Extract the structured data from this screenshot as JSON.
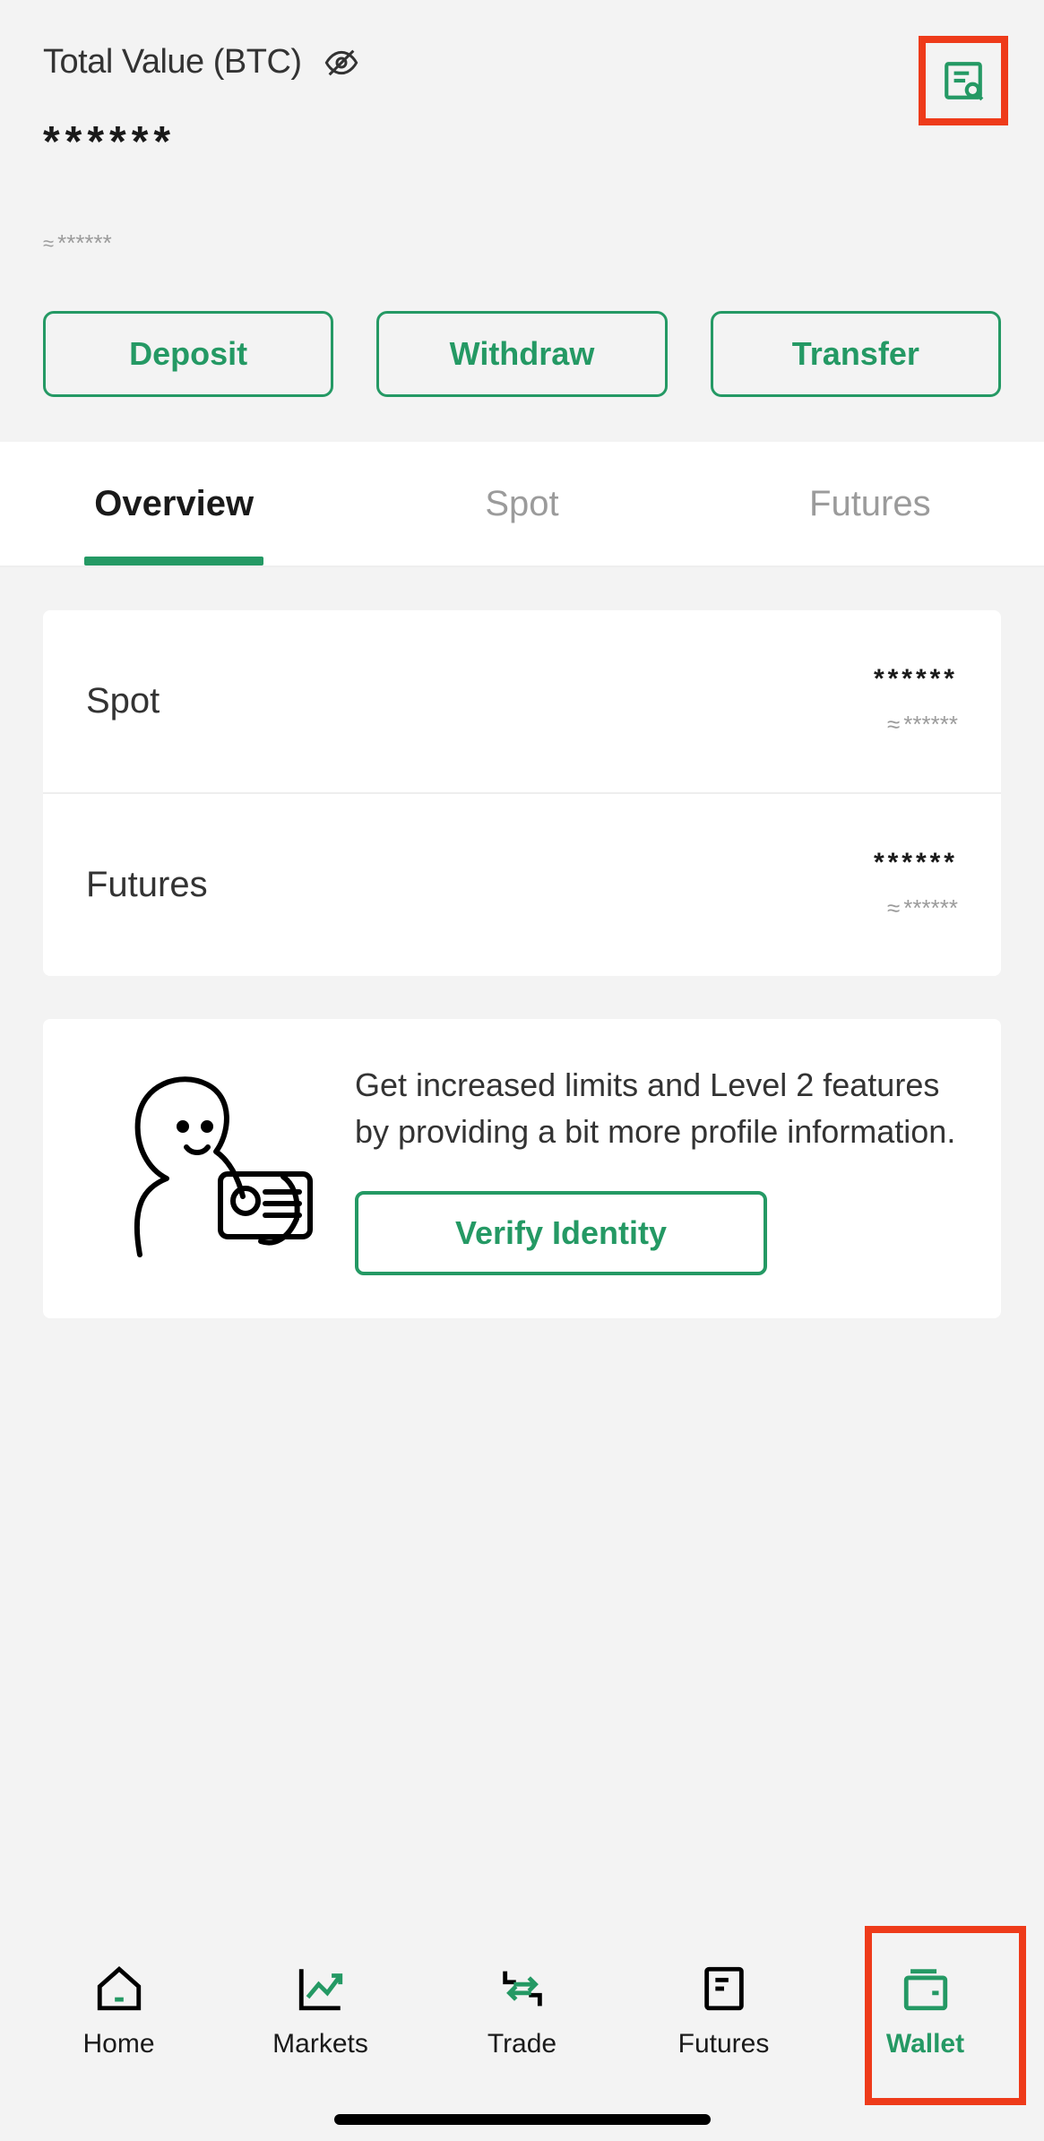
{
  "header": {
    "total_label": "Total Value (BTC)",
    "main_value": "******",
    "approx_value": "******"
  },
  "actions": {
    "deposit": "Deposit",
    "withdraw": "Withdraw",
    "transfer": "Transfer"
  },
  "tabs": {
    "overview": "Overview",
    "spot": "Spot",
    "futures": "Futures"
  },
  "overview_rows": {
    "spot": {
      "label": "Spot",
      "main": "******",
      "sub": "******"
    },
    "futures": {
      "label": "Futures",
      "main": "******",
      "sub": "******"
    }
  },
  "verify": {
    "text": "Get increased limits and Level 2 features by providing a bit more profile information.",
    "button": "Verify Identity"
  },
  "nav": {
    "home": "Home",
    "markets": "Markets",
    "trade": "Trade",
    "futures": "Futures",
    "wallet": "Wallet"
  },
  "colors": {
    "accent": "#249964",
    "highlight": "#ee3b1a"
  }
}
